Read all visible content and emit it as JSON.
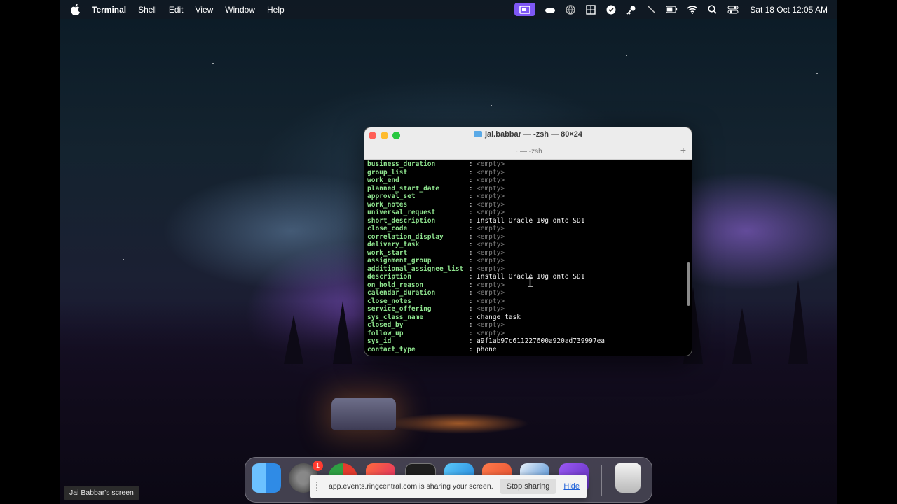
{
  "menubar": {
    "apple_icon": "apple-logo-icon",
    "app_name": "Terminal",
    "items": [
      "Shell",
      "Edit",
      "View",
      "Window",
      "Help"
    ],
    "status_icons": [
      "screen-share-icon",
      "cloud-icon",
      "globe-icon",
      "grid-icon",
      "sync-icon",
      "key-icon",
      "slash-icon",
      "battery-icon",
      "wifi-icon",
      "search-icon",
      "control-center-icon"
    ],
    "clock": "Sat 18 Oct  12:05 AM"
  },
  "terminal": {
    "title": "jai.babbar — -zsh — 80×24",
    "tab_label": "~ — -zsh",
    "new_tab": "+",
    "rows": [
      {
        "key": "business_duration",
        "value": "<empty>",
        "empty": true
      },
      {
        "key": "group_list",
        "value": "<empty>",
        "empty": true
      },
      {
        "key": "work_end",
        "value": "<empty>",
        "empty": true
      },
      {
        "key": "planned_start_date",
        "value": "<empty>",
        "empty": true
      },
      {
        "key": "approval_set",
        "value": "<empty>",
        "empty": true
      },
      {
        "key": "work_notes",
        "value": "<empty>",
        "empty": true
      },
      {
        "key": "universal_request",
        "value": "<empty>",
        "empty": true
      },
      {
        "key": "short_description",
        "value": "Install Oracle 10g onto SD1",
        "empty": false
      },
      {
        "key": "close_code",
        "value": "<empty>",
        "empty": true
      },
      {
        "key": "correlation_display",
        "value": "<empty>",
        "empty": true
      },
      {
        "key": "delivery_task",
        "value": "<empty>",
        "empty": true
      },
      {
        "key": "work_start",
        "value": "<empty>",
        "empty": true
      },
      {
        "key": "assignment_group",
        "value": "<empty>",
        "empty": true
      },
      {
        "key": "additional_assignee_list",
        "value": "<empty>",
        "empty": true
      },
      {
        "key": "description",
        "value": "Install Oracle 10g onto SD1",
        "empty": false
      },
      {
        "key": "on_hold_reason",
        "value": "<empty>",
        "empty": true
      },
      {
        "key": "calendar_duration",
        "value": "<empty>",
        "empty": true
      },
      {
        "key": "close_notes",
        "value": "<empty>",
        "empty": true
      },
      {
        "key": "service_offering",
        "value": "<empty>",
        "empty": true
      },
      {
        "key": "sys_class_name",
        "value": "change_task",
        "empty": false
      },
      {
        "key": "closed_by",
        "value": "<empty>",
        "empty": true
      },
      {
        "key": "follow_up",
        "value": "<empty>",
        "empty": true
      },
      {
        "key": "sys_id",
        "value": "a9f1ab97c611227600a920ad739997ea",
        "empty": false
      },
      {
        "key": "contact_type",
        "value": "phone",
        "empty": false
      }
    ],
    "separator": ":"
  },
  "dock": {
    "apps": [
      "finder-icon",
      "system-settings-icon",
      "chrome-icon",
      "office-icon",
      "terminal-icon",
      "xcode-icon",
      "app-icon",
      "app-icon-2",
      "app-icon-3",
      "trash-icon"
    ],
    "badge": "1"
  },
  "sharing": {
    "message": "app.events.ringcentral.com is sharing your screen.",
    "stop_label": "Stop sharing",
    "hide_label": "Hide"
  },
  "screen_label": "Jai Babbar's screen"
}
